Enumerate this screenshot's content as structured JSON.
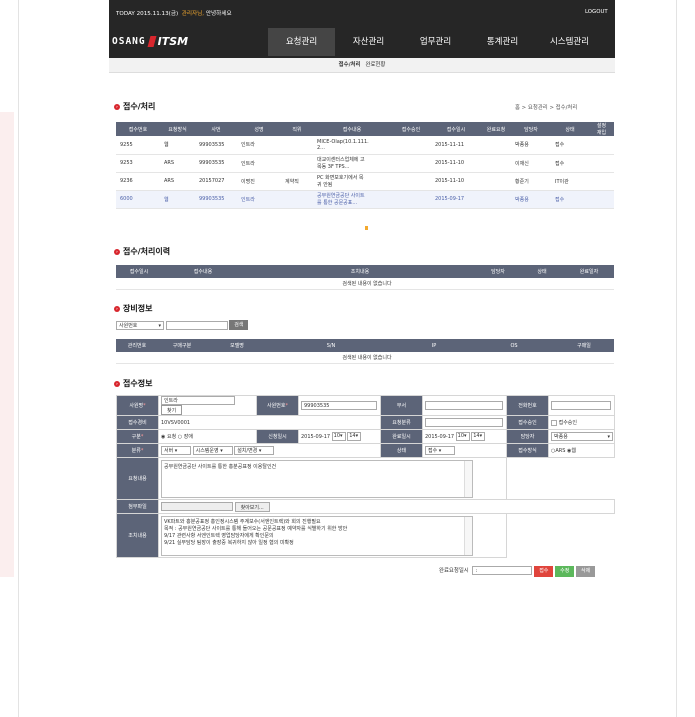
{
  "top": {
    "today": "TODAY 2015.11.13(금)",
    "user_hl": "관리자님,",
    "user_tail": "안녕하세요",
    "logout": "LOGOUT"
  },
  "logo": {
    "brand": "OSANG",
    "product": "ITSM"
  },
  "gnb": [
    "요청관리",
    "자산관리",
    "업무관리",
    "통계관리",
    "시스템관리"
  ],
  "sub": {
    "active": "접수/처리",
    "other": "완료현황"
  },
  "sec1": {
    "title": "접수/처리",
    "breadcrumb": "홈 > 요청관리 > 접수/처리"
  },
  "table1": {
    "headers": [
      "접수번호",
      "요청방식",
      "사번",
      "성명",
      "직위",
      "접수내용",
      "접수승인",
      "접수일시",
      "완료요청",
      "담당자",
      "상태",
      "설정\n재입"
    ],
    "rows": [
      [
        "9255",
        "웹",
        "99903535",
        "인트라",
        "",
        "MICE-Olap(10.1.111.\n2...",
        "",
        "2015-11-11",
        "",
        "박종용",
        "접수",
        ""
      ],
      [
        "9253",
        "ARS",
        "99903535",
        "인트라",
        "",
        "대교이센터스업체에 고\n목동 3F TPS...",
        "",
        "2015-11-10",
        "",
        "이재신",
        "접수",
        ""
      ],
      [
        "9236",
        "ARS",
        "20157027",
        "이명진",
        "계약직",
        "PC 화면보호기에서 목\n귀 안됨",
        "",
        "2015-11-10",
        "",
        "황준기",
        "IT이관",
        ""
      ],
      [
        "6000",
        "웹",
        "99903535",
        "인트라",
        "",
        "공무원연금공단 사이트\n를 통한 공문공표...",
        "",
        "2015-09-17",
        "",
        "박종용",
        "접수",
        ""
      ]
    ]
  },
  "sec2": {
    "title": "접수/처리이력",
    "headers": [
      "접수일시",
      "접수내용",
      "조치내용",
      "담당자",
      "상태",
      "완료일자"
    ],
    "empty": "검색된 내용이 없습니다"
  },
  "sec3": {
    "title": "장비정보",
    "filter": "사원번호",
    "search_btn": "검색",
    "headers": [
      "관리번호",
      "구매구분",
      "모델명",
      "S/N",
      "IP",
      "OS",
      "구매일"
    ],
    "empty": "검색된 내용이 없습니다"
  },
  "sec4": {
    "title": "접수정보",
    "labels": {
      "emp": "사원명",
      "empno": "사원번호",
      "dept": "부서",
      "tel": "전화번호",
      "acc": "접수경비",
      "reqdept": "요청분류",
      "appr": "접수승인",
      "type": "구분",
      "appdate": "신청일시",
      "done": "완료일시",
      "owner": "담당자",
      "cat": "분류",
      "state": "상태",
      "method": "접수방식",
      "req": "요청내용",
      "file": "첨부파일",
      "act": "조치내용"
    },
    "emp": "인트라",
    "find": "찾기",
    "empno": "99903535",
    "acc": "10VSV0001",
    "appr_cb": "접수승인",
    "type_opts": [
      "요청",
      "장애"
    ],
    "appdate": "2015-09-17",
    "h1": "10",
    "m1": "14",
    "done": "2015-09-17",
    "h2": "10",
    "m2": "14",
    "owner": "박종용",
    "cat": [
      "서버",
      "시스템운영",
      "설치/변경"
    ],
    "state": "접수",
    "method_opts": [
      "ARS",
      "웹"
    ],
    "req_text": "공무원연금공단 사이트를 통한 홍분공표정 이용탈인건",
    "browse": "찾아보기...",
    "act_lines": [
      "VK파트와 홍분공표정 홍인정시스템 주계보수(서엔인트렉)와 회의 진행필요",
      "목적 : 공무원연금공단 사이트를 통해 들어오는 공문공표정 예약자를 식별하기 위한 방안",
      "",
      "9/17 관련사항 서엔인트렉 영업담당자에게 확인문의",
      "9/21 실무담당 팀장이 출장중 복귀하지 않아 일정 협의 미확정"
    ],
    "done_req": "완료요청일시",
    "done_req_val": ":",
    "btns": [
      "접수",
      "수정",
      "삭제"
    ]
  }
}
